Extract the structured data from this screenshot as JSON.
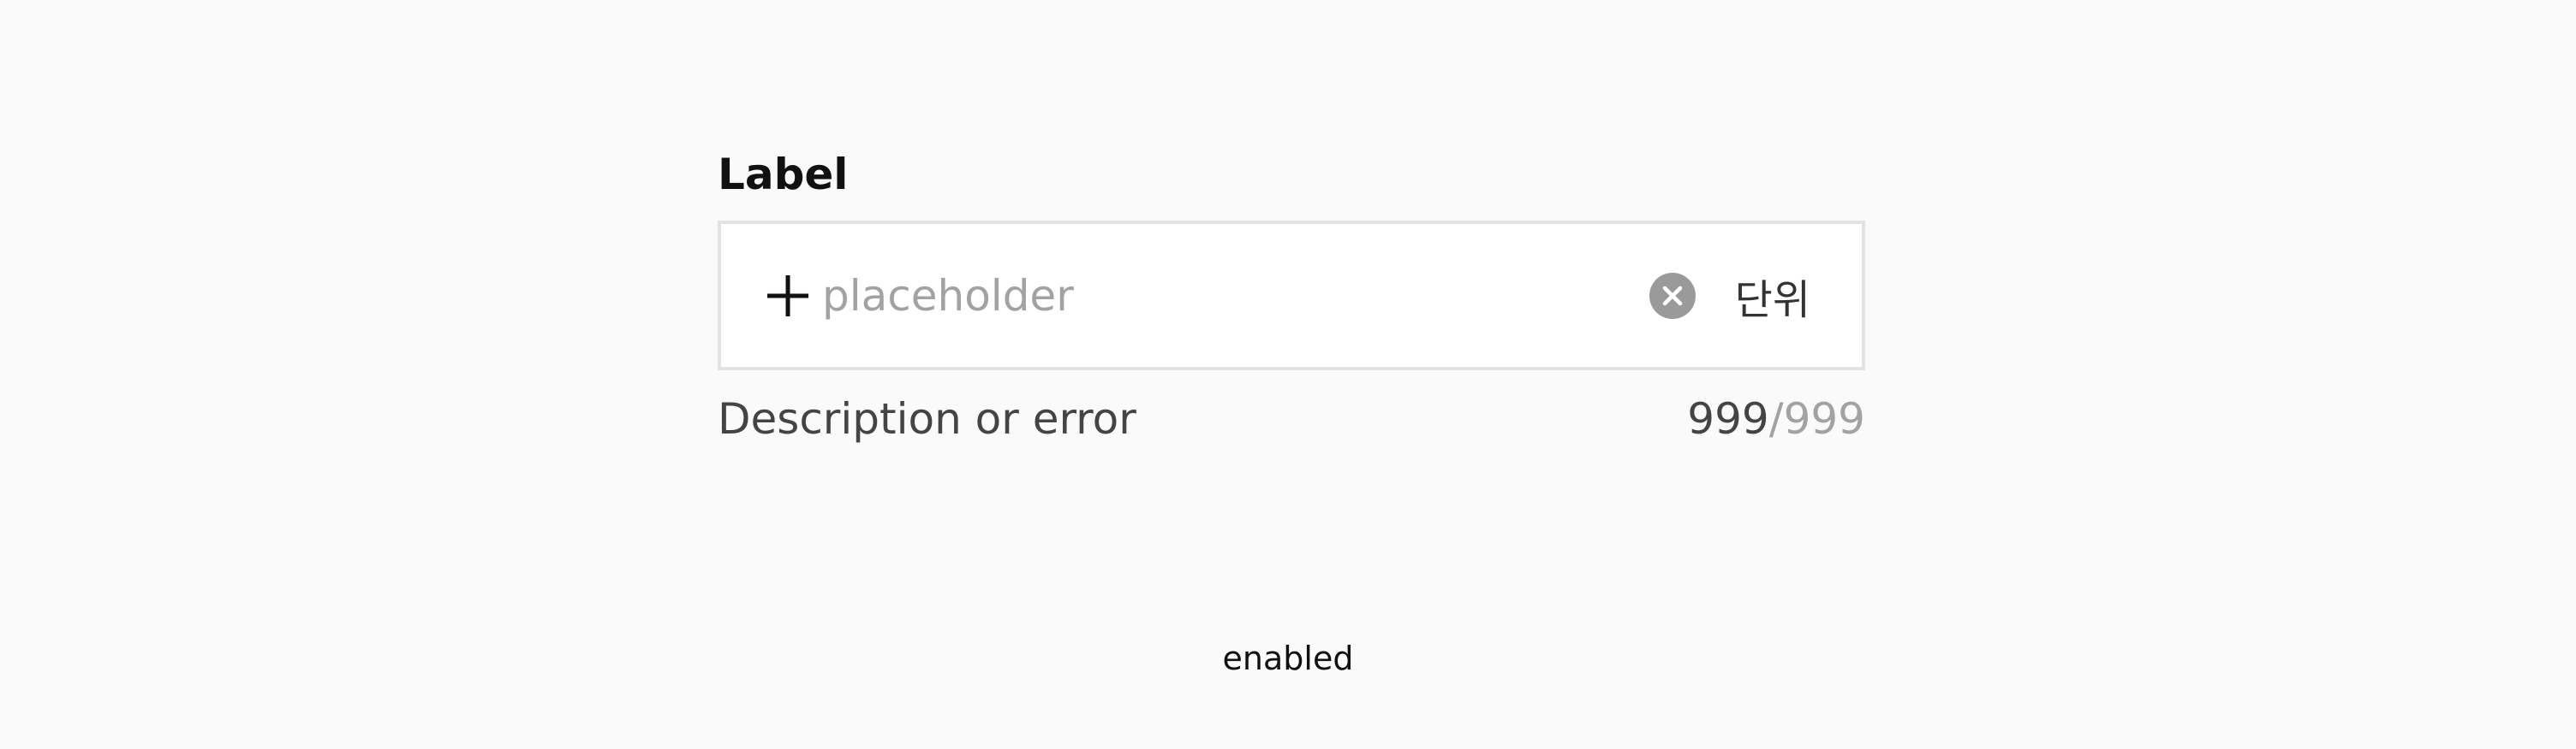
{
  "field": {
    "label": "Label",
    "placeholder": "placeholder",
    "value": "",
    "unit": "단위",
    "description": "Description or error",
    "counter": {
      "current": "999",
      "separator": "/",
      "max": "999"
    },
    "icons": {
      "leading": "plus-icon",
      "clear": "clear-icon"
    }
  },
  "state_caption": "enabled",
  "colors": {
    "background": "#fafafa",
    "input_border": "#e3e3e3",
    "placeholder": "#a2a2a2",
    "clear_icon_bg": "#9a9a9a"
  }
}
